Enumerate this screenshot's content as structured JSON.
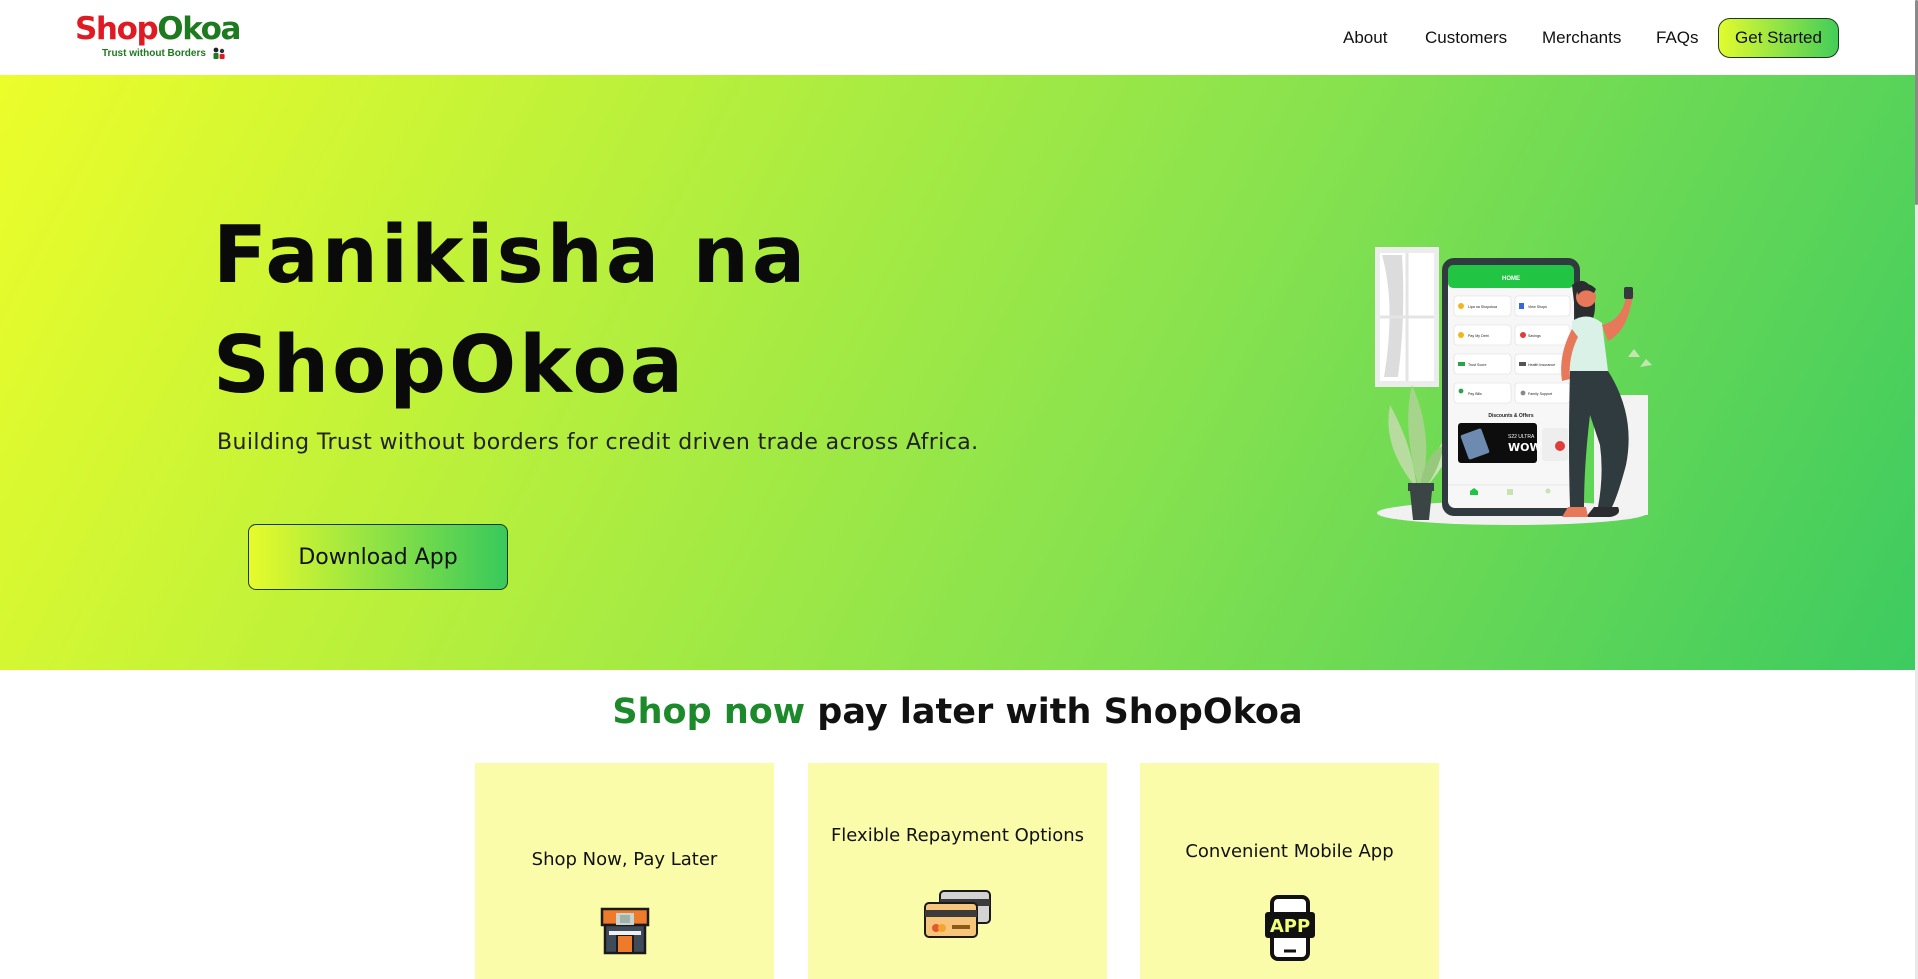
{
  "logo": {
    "word_part1": "Shop",
    "word_part2": "Okoa",
    "tagline": "Trust without Borders"
  },
  "nav": {
    "links": [
      "About",
      "Customers",
      "Merchants",
      "FAQs"
    ],
    "cta": "Get Started"
  },
  "hero": {
    "title_line1": "Fanikisha na",
    "title_line2": "ShopOkoa",
    "subtitle": "Building Trust without borders for credit driven trade across Africa.",
    "button": "Download App",
    "phone": {
      "header": "HOME",
      "tiles": [
        "Lipa na Shopokoa",
        "View Shops",
        "Pay My Debt",
        "Savings",
        "Trust Score",
        "Health Insurance",
        "Pay Bills",
        "Family Support"
      ],
      "section": "Discounts & Offers",
      "promo_line1": "S22 ULTRA",
      "promo_line2": "WOW"
    }
  },
  "features": {
    "title_accent": "Shop now",
    "title_rest": " pay later with ShopOkoa",
    "cards": [
      {
        "title": "Shop Now, Pay Later",
        "icon": "store-icon"
      },
      {
        "title": "Flexible Repayment Options",
        "icon": "credit-cards-icon"
      },
      {
        "title": "Convenient Mobile App",
        "icon": "mobile-app-icon",
        "icon_text": "APP"
      }
    ]
  },
  "colors": {
    "brand_red": "#e01a22",
    "brand_green": "#1d7a1f",
    "accent_green": "#1c8a2b",
    "gradient_start": "#ecfd2a",
    "gradient_end": "#3dcb60",
    "card_bg": "#fafcaa"
  }
}
